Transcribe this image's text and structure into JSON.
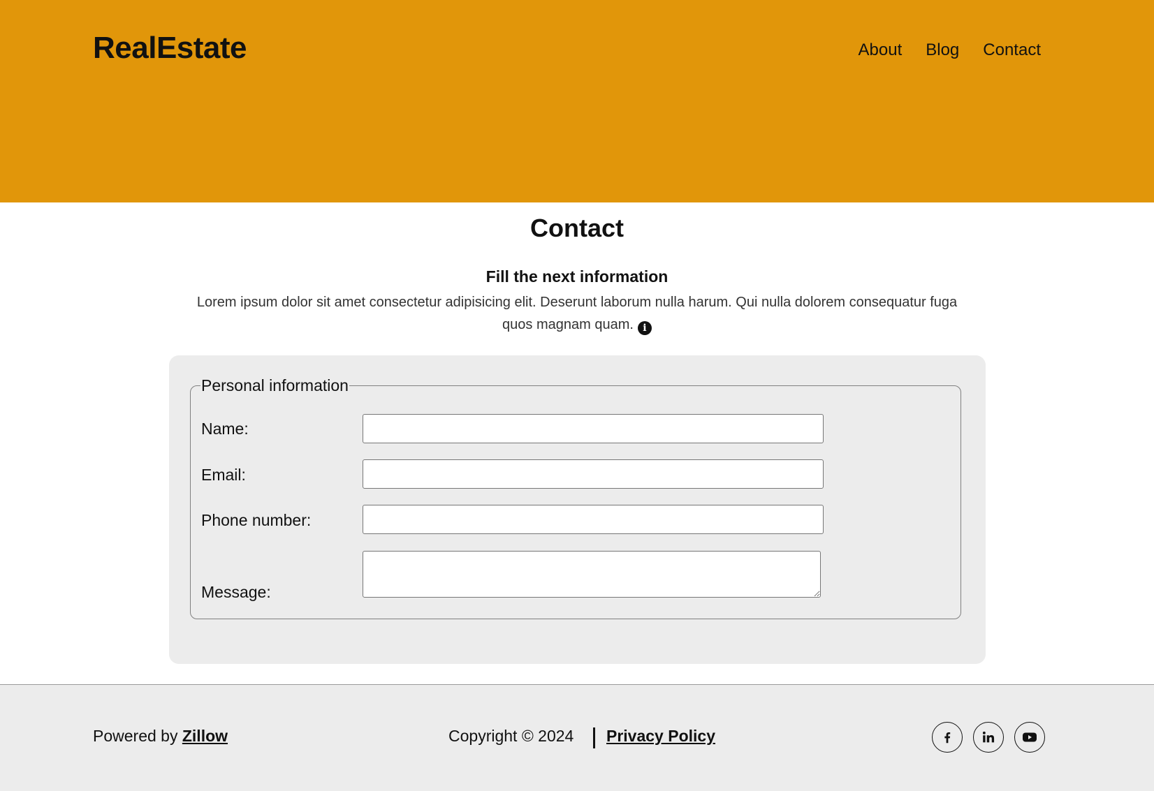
{
  "header": {
    "logo": "RealEstate",
    "nav": [
      {
        "label": "About"
      },
      {
        "label": "Blog"
      },
      {
        "label": "Contact"
      }
    ],
    "background": "#e1960a"
  },
  "main": {
    "title": "Contact",
    "subheading": "Fill the next information",
    "description": "Lorem ipsum dolor sit amet consectetur adipisicing elit. Deserunt laborum nulla harum. Qui nulla dolorem consequatur fuga quos magnam quam.",
    "form": {
      "legend": "Personal information",
      "fields": {
        "name": {
          "label": "Name:",
          "value": ""
        },
        "email": {
          "label": "Email:",
          "value": ""
        },
        "phone": {
          "label": "Phone number:",
          "value": ""
        },
        "message": {
          "label": "Message:",
          "value": ""
        }
      }
    }
  },
  "footer": {
    "powered_prefix": "Powered by ",
    "powered_link": "Zillow",
    "copyright": "Copyright © 2024",
    "privacy": "Privacy Policy",
    "social_icons": [
      "facebook-icon",
      "linkedin-icon",
      "youtube-icon"
    ]
  }
}
